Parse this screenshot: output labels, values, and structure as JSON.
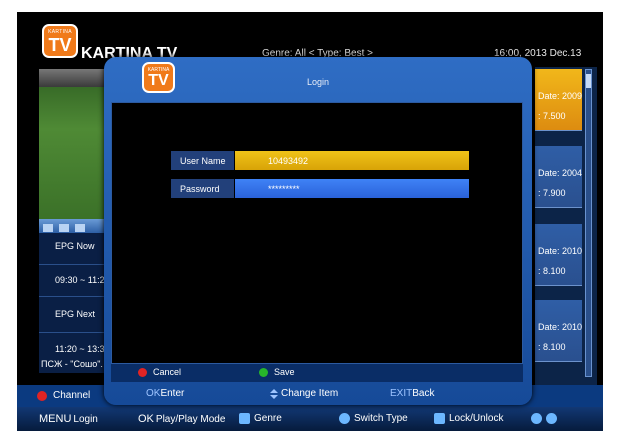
{
  "header": {
    "logo_small": "KARTINA",
    "logo_big": "TV",
    "brand": "KARTINA TV",
    "genre_line": "Genre: All < Type: Best >",
    "clock": "16:00, 2013 Dec.13"
  },
  "epg": {
    "now_label": "EPG Now",
    "now_time": "09:30 ~ 11:2",
    "next_label": "EPG Next",
    "next_time": "11:20 ~ 13:3",
    "program": "ПСЖ - \"Сошо\"."
  },
  "channel_cards": [
    {
      "line1": "Date: 2009",
      "line2": ": 7.500"
    },
    {
      "line1": "Date: 2004",
      "line2": ": 7.900"
    },
    {
      "line1": "Date: 2010",
      "line2": ": 8.100"
    },
    {
      "line1": "Date: 2010",
      "line2": ": 8.100"
    }
  ],
  "dialog": {
    "title": "Login",
    "username_label": "User Name",
    "username_value": "10493492",
    "password_label": "Password",
    "password_value": "*********",
    "cancel_label": "Cancel",
    "save_label": "Save",
    "ok_key": "OK",
    "ok_action": "Enter",
    "change_action": "Change Item",
    "exit_key": "EXIT",
    "exit_action": "Back"
  },
  "channel_bar": {
    "label": "Channel"
  },
  "help_bar": {
    "menu_key": "MENU",
    "menu_action": "Login",
    "ok_key": "OK",
    "ok_action": "Play/Play Mode",
    "genre_action": "Genre",
    "switch_action": "Switch Type",
    "lock_action": "Lock/Unlock"
  },
  "colors": {
    "accent_orange": "#f07a1a",
    "selected_yellow": "#f0c318",
    "focus_blue": "#3f82f6",
    "dialog_blue": "#2f6dc4",
    "red_key": "#e02424",
    "green_key": "#27b52b"
  }
}
